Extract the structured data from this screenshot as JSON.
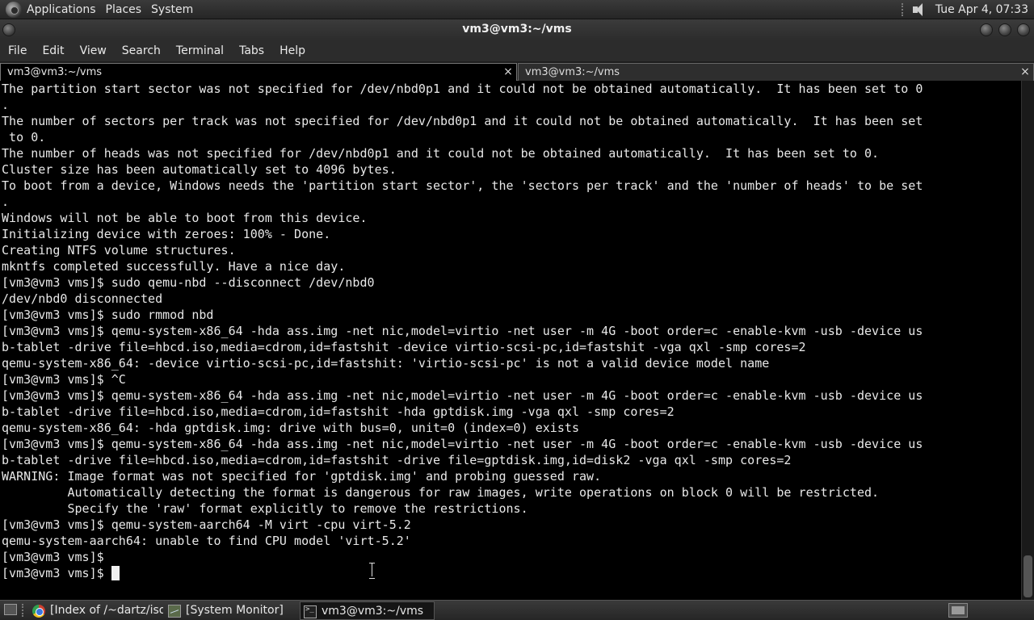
{
  "top_panel": {
    "menus": [
      "Applications",
      "Places",
      "System"
    ],
    "clock": "Tue Apr  4, 07:33"
  },
  "window": {
    "title": "vm3@vm3:~/vms"
  },
  "menubar": {
    "items": [
      "File",
      "Edit",
      "View",
      "Search",
      "Terminal",
      "Tabs",
      "Help"
    ]
  },
  "tabs": [
    {
      "label": "vm3@vm3:~/vms",
      "close": "×"
    },
    {
      "label": "vm3@vm3:~/vms",
      "close": "×"
    }
  ],
  "terminal": {
    "lines": [
      "The partition start sector was not specified for /dev/nbd0p1 and it could not be obtained automatically.  It has been set to 0",
      ".",
      "The number of sectors per track was not specified for /dev/nbd0p1 and it could not be obtained automatically.  It has been set",
      " to 0.",
      "The number of heads was not specified for /dev/nbd0p1 and it could not be obtained automatically.  It has been set to 0.",
      "Cluster size has been automatically set to 4096 bytes.",
      "To boot from a device, Windows needs the 'partition start sector', the 'sectors per track' and the 'number of heads' to be set",
      ".",
      "Windows will not be able to boot from this device.",
      "Initializing device with zeroes: 100% - Done.",
      "Creating NTFS volume structures.",
      "mkntfs completed successfully. Have a nice day.",
      "[vm3@vm3 vms]$ sudo qemu-nbd --disconnect /dev/nbd0",
      "/dev/nbd0 disconnected",
      "[vm3@vm3 vms]$ sudo rmmod nbd",
      "[vm3@vm3 vms]$ qemu-system-x86_64 -hda ass.img -net nic,model=virtio -net user -m 4G -boot order=c -enable-kvm -usb -device us",
      "b-tablet -drive file=hbcd.iso,media=cdrom,id=fastshit -device virtio-scsi-pc,id=fastshit -vga qxl -smp cores=2",
      "qemu-system-x86_64: -device virtio-scsi-pc,id=fastshit: 'virtio-scsi-pc' is not a valid device model name",
      "[vm3@vm3 vms]$ ^C",
      "[vm3@vm3 vms]$ qemu-system-x86_64 -hda ass.img -net nic,model=virtio -net user -m 4G -boot order=c -enable-kvm -usb -device us",
      "b-tablet -drive file=hbcd.iso,media=cdrom,id=fastshit -hda gptdisk.img -vga qxl -smp cores=2",
      "qemu-system-x86_64: -hda gptdisk.img: drive with bus=0, unit=0 (index=0) exists",
      "[vm3@vm3 vms]$ qemu-system-x86_64 -hda ass.img -net nic,model=virtio -net user -m 4G -boot order=c -enable-kvm -usb -device us",
      "b-tablet -drive file=hbcd.iso,media=cdrom,id=fastshit -drive file=gptdisk.img,id=disk2 -vga qxl -smp cores=2",
      "WARNING: Image format was not specified for 'gptdisk.img' and probing guessed raw.",
      "         Automatically detecting the format is dangerous for raw images, write operations on block 0 will be restricted.",
      "         Specify the 'raw' format explicitly to remove the restrictions.",
      "[vm3@vm3 vms]$ qemu-system-aarch64 -M virt -cpu virt-5.2",
      "qemu-system-aarch64: unable to find CPU model 'virt-5.2'",
      "[vm3@vm3 vms]$ ",
      "[vm3@vm3 vms]$ "
    ]
  },
  "taskbar": {
    "tasks": [
      {
        "label": "[Index of /~dartz/iso...",
        "icon": "chrome-icon"
      },
      {
        "label": "[System Monitor]",
        "icon": "system-monitor-icon"
      },
      {
        "label": "vm3@vm3:~/vms",
        "icon": "terminal-icon"
      }
    ]
  }
}
